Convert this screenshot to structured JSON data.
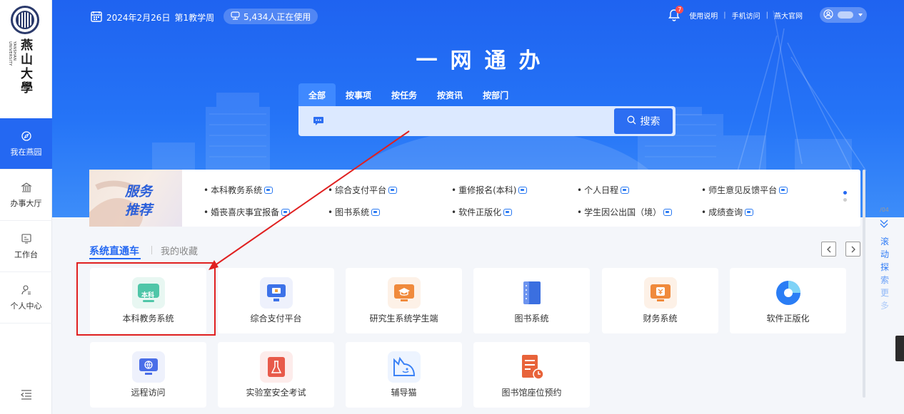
{
  "sidebar": {
    "logo_text": "燕山大學",
    "logo_sub": "YANSHAN UNIVERSITY",
    "items": [
      {
        "label": "我在燕园",
        "icon": "compass-icon"
      },
      {
        "label": "办事大厅",
        "icon": "hall-icon"
      },
      {
        "label": "工作台",
        "icon": "workbench-icon"
      },
      {
        "label": "个人中心",
        "icon": "person-icon"
      }
    ]
  },
  "header": {
    "date": "2024年2月26日",
    "week": "第1教学周",
    "online": "5,434人正在使用",
    "notif_count": "7",
    "links": [
      "使用说明",
      "手机访问",
      "燕大官网"
    ]
  },
  "hero": {
    "title": "一网通办",
    "tabs": [
      "全部",
      "按事项",
      "按任务",
      "按资讯",
      "按部门"
    ],
    "search_button": "搜索",
    "search_placeholder": ""
  },
  "service": {
    "banner_line1": "服务",
    "banner_line2": "推荐",
    "row1": [
      "本科教务系统",
      "综合支付平台",
      "重修报名(本科)",
      "个人日程",
      "师生意见反馈平台"
    ],
    "row2": [
      "婚丧喜庆事宜报备",
      "图书系统",
      "软件正版化",
      "学生因公出国（境）",
      "成绩查询"
    ]
  },
  "section": {
    "title": "系统直通车",
    "favorites": "我的收藏"
  },
  "cards": [
    {
      "label": "本科教务系统",
      "icon": "undergrad-academic-icon",
      "icon_text": "本科",
      "color": "#4fc6a8"
    },
    {
      "label": "综合支付平台",
      "icon": "payment-platform-icon",
      "color": "#3d72e8"
    },
    {
      "label": "研究生系统学生端",
      "icon": "graduate-system-icon",
      "color": "#f08a3c"
    },
    {
      "label": "图书系统",
      "icon": "library-book-icon",
      "color": "#3b6fe0"
    },
    {
      "label": "财务系统",
      "icon": "finance-icon",
      "color": "#f08a3c"
    },
    {
      "label": "软件正版化",
      "icon": "software-pie-icon",
      "color": "#2a7df5"
    },
    {
      "label": "远程访问",
      "icon": "remote-access-icon",
      "color": "#4a6ee8"
    },
    {
      "label": "实验室安全考试",
      "icon": "lab-safety-icon",
      "color": "#e85a4a"
    },
    {
      "label": "辅导猫",
      "icon": "tutor-cat-icon",
      "color": "#3b82f6"
    },
    {
      "label": "图书馆座位预约",
      "icon": "library-seat-icon",
      "color": "#e8633a"
    }
  ],
  "scroll_hint": {
    "page": "/04",
    "words": [
      "滚",
      "动",
      "探",
      "索",
      "更",
      "多"
    ]
  }
}
